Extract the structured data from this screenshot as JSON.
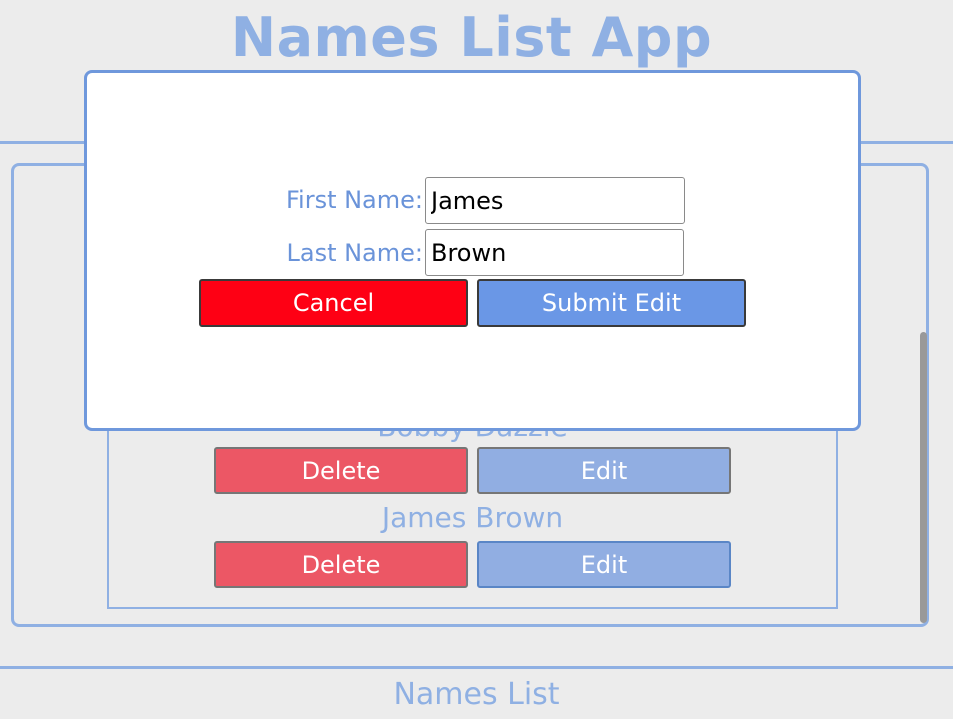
{
  "app": {
    "title": "Names List App",
    "footer_title": "Names List"
  },
  "list": {
    "items": [
      {
        "name": "Bobby Dazzle",
        "delete_label": "Delete",
        "edit_label": "Edit"
      },
      {
        "name": "James Brown",
        "delete_label": "Delete",
        "edit_label": "Edit"
      }
    ]
  },
  "modal": {
    "first_name_label": "First Name:",
    "first_name_value": "James",
    "last_name_label": "Last Name:",
    "last_name_value": "Brown",
    "cancel_label": "Cancel",
    "submit_label": "Submit Edit"
  },
  "colors": {
    "accent": "#8fb0e3",
    "modal_border": "#6f98dc",
    "cancel": "#fe0014",
    "submit": "#6a97e6",
    "delete": "#ec5765",
    "edit": "#91aee2",
    "background": "#ececec"
  }
}
